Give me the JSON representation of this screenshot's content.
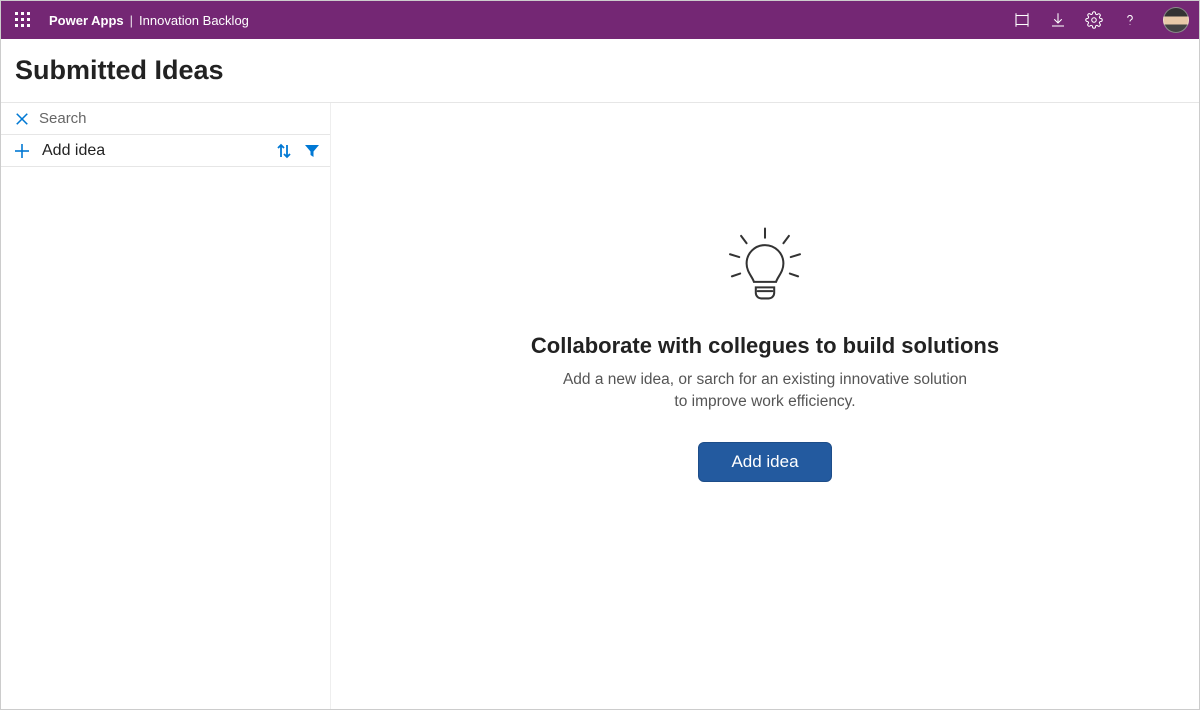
{
  "header": {
    "brand": "Power Apps",
    "app_name": "Innovation Backlog"
  },
  "page": {
    "title": "Submitted Ideas"
  },
  "sidebar": {
    "search_placeholder": "Search",
    "add_idea_label": "Add idea"
  },
  "empty_state": {
    "heading": "Collaborate with collegues to build solutions",
    "subtext": "Add a new idea, or sarch for an existing innovative solution to improve work efficiency.",
    "button_label": "Add idea"
  }
}
